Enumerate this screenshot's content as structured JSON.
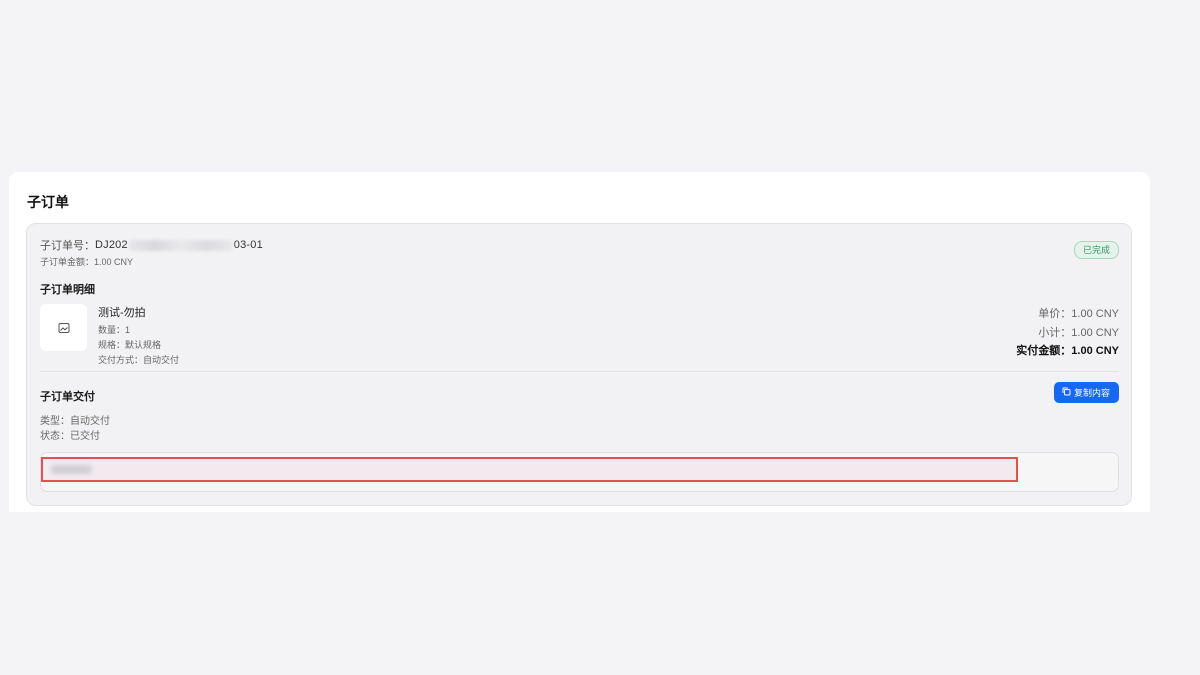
{
  "panel": {
    "title": "子订单"
  },
  "suborder": {
    "order_no_label": "子订单号：",
    "order_no_prefix": "DJ202",
    "order_no_suffix": "03-01",
    "amount_label": "子订单金额：",
    "amount_value": "1.00 CNY",
    "status": "已完成"
  },
  "detail": {
    "title": "子订单明细",
    "product_name": "测试-勿拍",
    "quantity": "数量：1",
    "spec": "规格：默认规格",
    "delivery_method": "交付方式：自动交付",
    "unit_price": "单价：1.00 CNY",
    "subtotal": "小计：1.00 CNY",
    "paid_amount": "实付金额：1.00 CNY"
  },
  "delivery": {
    "title": "子订单交付",
    "copy_button": "复制内容",
    "type": "类型：自动交付",
    "status": "状态：已交付"
  },
  "colors": {
    "accent": "#1668f2",
    "status_green": "#3a9466",
    "highlight_red": "#e05252"
  },
  "icons": {
    "thumb": "image-icon",
    "copy": "copy-icon"
  }
}
